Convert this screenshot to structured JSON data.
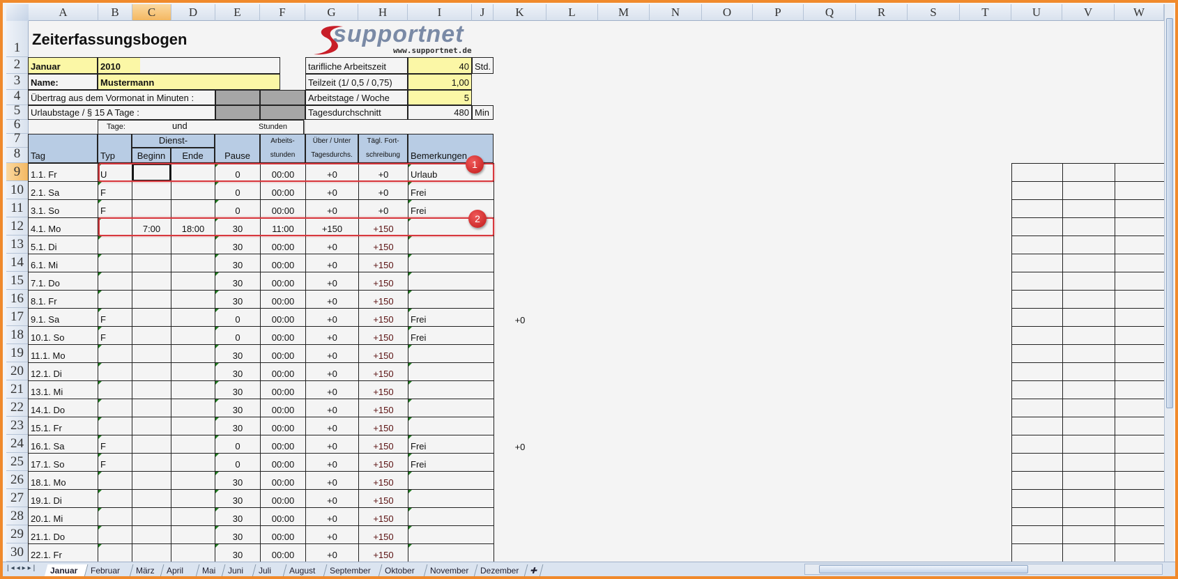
{
  "columns": [
    "A",
    "B",
    "C",
    "D",
    "E",
    "F",
    "G",
    "H",
    "I",
    "J",
    "K",
    "L",
    "M",
    "N",
    "O",
    "P",
    "Q",
    "R",
    "S",
    "T",
    "U",
    "V",
    "W"
  ],
  "title": "Zeiterfassungsbogen",
  "logo": {
    "brand": "supportnet",
    "url": "www.supportnet.de"
  },
  "header": {
    "month": "Januar",
    "year": "2010",
    "name_label": "Name:",
    "name": "Mustermann",
    "carry_label": "Übertrag aus dem Vormonat in Minuten :",
    "vacation_label": "Urlaubstage / § 15 A Tage :",
    "tarif_label": "tarifliche Arbeitszeit",
    "tarif_value": "40",
    "tarif_unit": "Std.",
    "part_label": "Teilzeit (1/  0,5 / 0,75)",
    "part_value": "1,00",
    "days_label": "Arbeitstage / Woche",
    "days_value": "5",
    "avg_label": "Tagesdurchschnitt",
    "avg_value": "480",
    "avg_unit": "Min",
    "tage": "Tage:",
    "und": "und",
    "stunden": "Stunden"
  },
  "table_header": {
    "tag": "Tag",
    "typ": "Typ",
    "dienst": "Dienst-",
    "beginn": "Beginn",
    "ende": "Ende",
    "pause": "Pause",
    "arbeits1": "Arbeits-",
    "arbeits2": "stunden",
    "ueber1": "Über / Unter",
    "ueber2": "Tagesdurchs.",
    "fort1": "Tägl. Fort-",
    "fort2": "schreibung",
    "bem": "Bemerkungen"
  },
  "rows": [
    {
      "n": "9",
      "tag": "1.1. Fr",
      "typ": "U",
      "beginn": "",
      "ende": "",
      "pause": "0",
      "std": "00:00",
      "ueber": "+0",
      "fort": "+0",
      "bem": "Urlaub",
      "k": ""
    },
    {
      "n": "10",
      "tag": "2.1. Sa",
      "typ": "F",
      "beginn": "",
      "ende": "",
      "pause": "0",
      "std": "00:00",
      "ueber": "+0",
      "fort": "+0",
      "bem": "Frei",
      "k": ""
    },
    {
      "n": "11",
      "tag": "3.1. So",
      "typ": "F",
      "beginn": "",
      "ende": "",
      "pause": "0",
      "std": "00:00",
      "ueber": "+0",
      "fort": "+0",
      "bem": "Frei",
      "k": ""
    },
    {
      "n": "12",
      "tag": "4.1. Mo",
      "typ": "",
      "beginn": "7:00",
      "ende": "18:00",
      "pause": "30",
      "std": "11:00",
      "ueber": "+150",
      "fort": "+150",
      "bem": "",
      "k": ""
    },
    {
      "n": "13",
      "tag": "5.1. Di",
      "typ": "",
      "beginn": "",
      "ende": "",
      "pause": "30",
      "std": "00:00",
      "ueber": "+0",
      "fort": "+150",
      "bem": "",
      "k": ""
    },
    {
      "n": "14",
      "tag": "6.1. Mi",
      "typ": "",
      "beginn": "",
      "ende": "",
      "pause": "30",
      "std": "00:00",
      "ueber": "+0",
      "fort": "+150",
      "bem": "",
      "k": ""
    },
    {
      "n": "15",
      "tag": "7.1. Do",
      "typ": "",
      "beginn": "",
      "ende": "",
      "pause": "30",
      "std": "00:00",
      "ueber": "+0",
      "fort": "+150",
      "bem": "",
      "k": ""
    },
    {
      "n": "16",
      "tag": "8.1. Fr",
      "typ": "",
      "beginn": "",
      "ende": "",
      "pause": "30",
      "std": "00:00",
      "ueber": "+0",
      "fort": "+150",
      "bem": "",
      "k": ""
    },
    {
      "n": "17",
      "tag": "9.1. Sa",
      "typ": "F",
      "beginn": "",
      "ende": "",
      "pause": "0",
      "std": "00:00",
      "ueber": "+0",
      "fort": "+150",
      "bem": "Frei",
      "k": "+0"
    },
    {
      "n": "18",
      "tag": "10.1. So",
      "typ": "F",
      "beginn": "",
      "ende": "",
      "pause": "0",
      "std": "00:00",
      "ueber": "+0",
      "fort": "+150",
      "bem": "Frei",
      "k": ""
    },
    {
      "n": "19",
      "tag": "11.1. Mo",
      "typ": "",
      "beginn": "",
      "ende": "",
      "pause": "30",
      "std": "00:00",
      "ueber": "+0",
      "fort": "+150",
      "bem": "",
      "k": ""
    },
    {
      "n": "20",
      "tag": "12.1. Di",
      "typ": "",
      "beginn": "",
      "ende": "",
      "pause": "30",
      "std": "00:00",
      "ueber": "+0",
      "fort": "+150",
      "bem": "",
      "k": ""
    },
    {
      "n": "21",
      "tag": "13.1. Mi",
      "typ": "",
      "beginn": "",
      "ende": "",
      "pause": "30",
      "std": "00:00",
      "ueber": "+0",
      "fort": "+150",
      "bem": "",
      "k": ""
    },
    {
      "n": "22",
      "tag": "14.1. Do",
      "typ": "",
      "beginn": "",
      "ende": "",
      "pause": "30",
      "std": "00:00",
      "ueber": "+0",
      "fort": "+150",
      "bem": "",
      "k": ""
    },
    {
      "n": "23",
      "tag": "15.1. Fr",
      "typ": "",
      "beginn": "",
      "ende": "",
      "pause": "30",
      "std": "00:00",
      "ueber": "+0",
      "fort": "+150",
      "bem": "",
      "k": ""
    },
    {
      "n": "24",
      "tag": "16.1. Sa",
      "typ": "F",
      "beginn": "",
      "ende": "",
      "pause": "0",
      "std": "00:00",
      "ueber": "+0",
      "fort": "+150",
      "bem": "Frei",
      "k": "+0"
    },
    {
      "n": "25",
      "tag": "17.1. So",
      "typ": "F",
      "beginn": "",
      "ende": "",
      "pause": "0",
      "std": "00:00",
      "ueber": "+0",
      "fort": "+150",
      "bem": "Frei",
      "k": ""
    },
    {
      "n": "26",
      "tag": "18.1. Mo",
      "typ": "",
      "beginn": "",
      "ende": "",
      "pause": "30",
      "std": "00:00",
      "ueber": "+0",
      "fort": "+150",
      "bem": "",
      "k": ""
    },
    {
      "n": "27",
      "tag": "19.1. Di",
      "typ": "",
      "beginn": "",
      "ende": "",
      "pause": "30",
      "std": "00:00",
      "ueber": "+0",
      "fort": "+150",
      "bem": "",
      "k": ""
    },
    {
      "n": "28",
      "tag": "20.1. Mi",
      "typ": "",
      "beginn": "",
      "ende": "",
      "pause": "30",
      "std": "00:00",
      "ueber": "+0",
      "fort": "+150",
      "bem": "",
      "k": ""
    },
    {
      "n": "29",
      "tag": "21.1. Do",
      "typ": "",
      "beginn": "",
      "ende": "",
      "pause": "30",
      "std": "00:00",
      "ueber": "+0",
      "fort": "+150",
      "bem": "",
      "k": ""
    },
    {
      "n": "30",
      "tag": "22.1. Fr",
      "typ": "",
      "beginn": "",
      "ende": "",
      "pause": "30",
      "std": "00:00",
      "ueber": "+0",
      "fort": "+150",
      "bem": "",
      "k": ""
    }
  ],
  "annotations": [
    "1",
    "2"
  ],
  "sheet_tabs": [
    "Januar",
    "Februar",
    "März",
    "April",
    "Mai",
    "Juni",
    "Juli",
    "August",
    "September",
    "Oktober",
    "November",
    "Dezember"
  ],
  "colors": {
    "accent": "#f08a2c",
    "header_fill": "#b8cce4",
    "input_fill": "#fbf7a6",
    "highlight": "#d8383e",
    "positive": "#7a1010"
  }
}
